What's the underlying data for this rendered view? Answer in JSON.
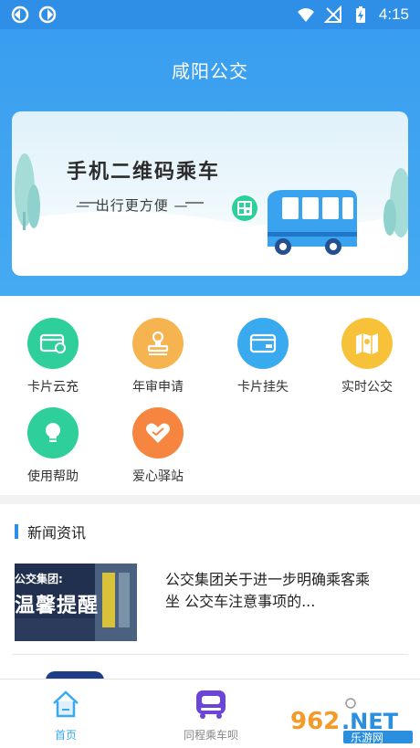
{
  "status_bar": {
    "time": "4:15"
  },
  "header": {
    "title": "咸阳公交"
  },
  "banner": {
    "title": "手机二维码乘车",
    "subtitle": "— 出行更方便 —"
  },
  "menu": {
    "items": [
      {
        "label": "卡片云充",
        "icon": "card-recharge-icon",
        "color": "#2ecf9a"
      },
      {
        "label": "年审申请",
        "icon": "stamp-icon",
        "color": "#f5b450"
      },
      {
        "label": "卡片挂失",
        "icon": "card-loss-icon",
        "color": "#3aaaf0"
      },
      {
        "label": "实时公交",
        "icon": "map-icon",
        "color": "#f7c23a"
      },
      {
        "label": "使用帮助",
        "icon": "lightbulb-icon",
        "color": "#2ecf9a"
      },
      {
        "label": "爱心驿站",
        "icon": "heart-icon",
        "color": "#f5853f"
      }
    ]
  },
  "news": {
    "heading": "新闻资讯",
    "items": [
      {
        "title": "公交集团关于进一步明确乘客乘坐 公交车注意事项的...",
        "thumb_line1": "公交集团:",
        "thumb_line2": "温馨提醒"
      }
    ]
  },
  "bottom_nav": {
    "items": [
      {
        "label": "首页",
        "active": true
      },
      {
        "label": "同程乘车呗",
        "active": false
      }
    ]
  },
  "watermark": {
    "brand": "962.NET",
    "sub": "乐游网"
  },
  "colors": {
    "accent": "#2f8fe6",
    "nav_active": "#3aaaf0",
    "nav_inactive": "#888888"
  }
}
